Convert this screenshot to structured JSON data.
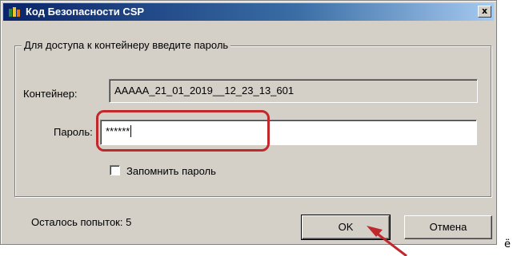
{
  "window": {
    "title": "Код Безопасности CSP",
    "close_label": "x",
    "icon": "csp-app-icon"
  },
  "group": {
    "legend": "Для доступа к контейнеру введите пароль"
  },
  "container": {
    "label": "Контейнер:",
    "value": "AAAAA_21_01_2019__12_23_13_601"
  },
  "password": {
    "label": "Пароль:",
    "value": "******"
  },
  "remember": {
    "label": "Запомнить пароль",
    "checked": false
  },
  "status": {
    "attempts_text": "Осталось попыток: 5"
  },
  "buttons": {
    "ok": "OK",
    "cancel": "Отмена"
  },
  "stray_char": "ё",
  "colors": {
    "highlight": "#c0282c",
    "titlebar": "#0a246a"
  }
}
